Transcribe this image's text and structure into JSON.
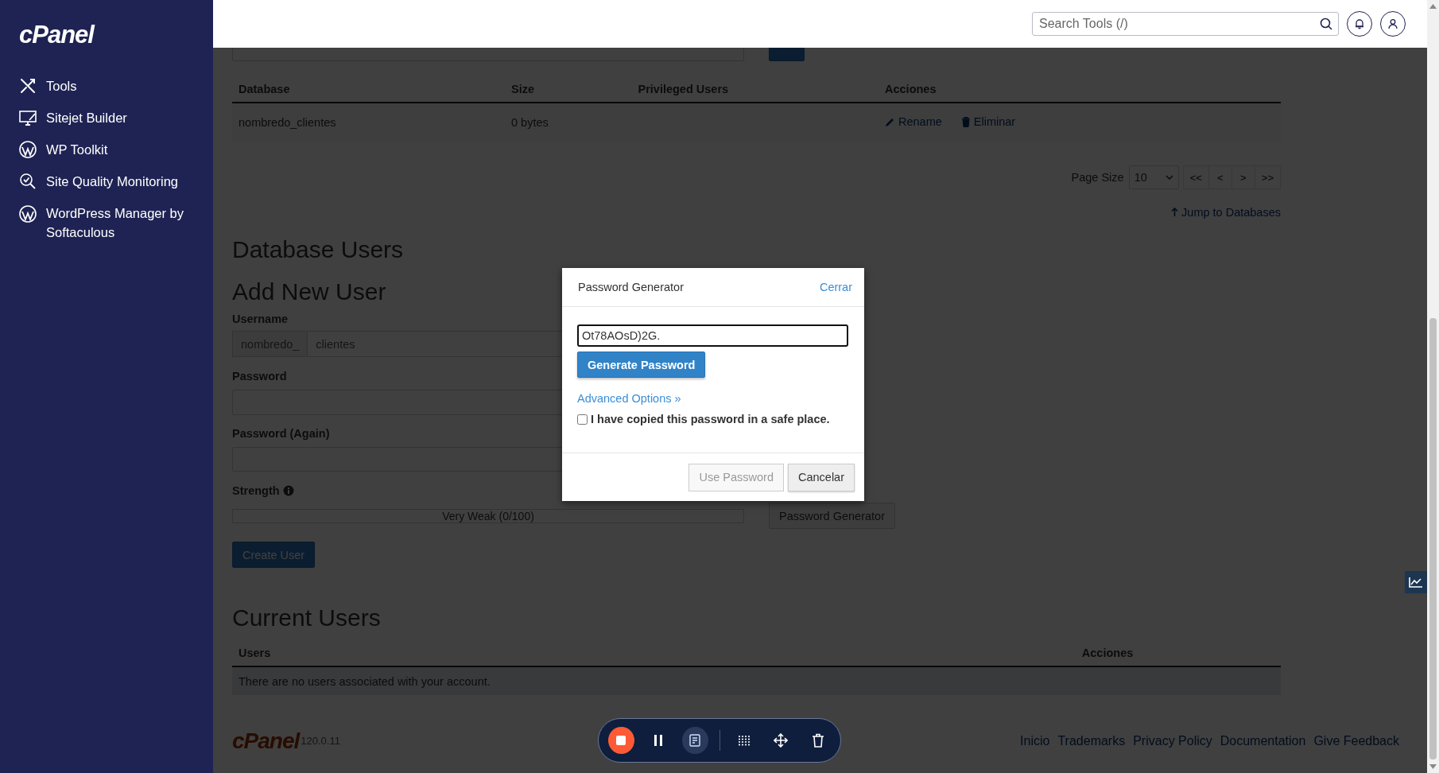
{
  "sidebar": {
    "logo": "cPanel",
    "items": [
      {
        "label": "Tools"
      },
      {
        "label": "Sitejet Builder"
      },
      {
        "label": "WP Toolkit"
      },
      {
        "label": "Site Quality Monitoring"
      },
      {
        "label": "WordPress Manager by Softaculous"
      }
    ]
  },
  "topbar": {
    "search": {
      "placeholder": "Search Tools (/)"
    }
  },
  "databases_table": {
    "columns": [
      "Database",
      "Size",
      "Privileged Users",
      "Acciones"
    ],
    "rows": [
      {
        "database": "nombredo_clientes",
        "size": "0 bytes",
        "actions": [
          "Rename",
          "Eliminar"
        ]
      }
    ]
  },
  "pagination": {
    "label": "Page Size",
    "page_size": "10",
    "buttons": [
      "<<",
      "<",
      ">",
      ">>"
    ]
  },
  "jump_link": "Jump to Databases",
  "section_title": "Database Users",
  "add_user": {
    "title": "Add New User",
    "username_label": "Username",
    "username_prefix": "nombredo_",
    "username_value": "clientes",
    "password_label": "Password",
    "password_again_label": "Password (Again)",
    "strength_label": "Strength",
    "strength": {
      "text": "Very Weak (0/100)"
    },
    "generator_button": "Password Generator",
    "submit": "Create User"
  },
  "current_users": {
    "title": "Current Users",
    "columns": [
      "Users",
      "Acciones"
    ],
    "empty_message": "There are no users associated with your account."
  },
  "footer": {
    "logo": "cPanel",
    "version": "120.0.11",
    "links": [
      "Inicio",
      "Trademarks",
      "Privacy Policy",
      "Documentation",
      "Give Feedback"
    ]
  },
  "modal": {
    "title": "Password Generator",
    "close": "Cerrar",
    "password": "Ot78AOsD)2G.",
    "generate": "Generate Password",
    "advanced": "Advanced Options »",
    "confirm": {
      "label": "I have copied this password in a safe place.",
      "checked": false
    },
    "buttons": [
      {
        "label": "Use Password",
        "disabled": true
      },
      {
        "label": "Cancelar",
        "disabled": false
      }
    ]
  }
}
